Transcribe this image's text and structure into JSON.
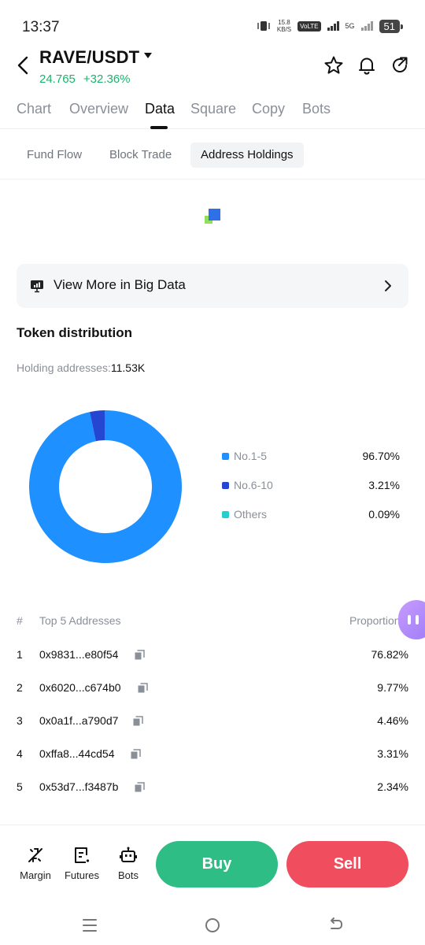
{
  "status_bar": {
    "time": "13:37",
    "speed_value": "15.8",
    "speed_unit": "KB/S",
    "volte": "VoLTE",
    "sim_slot": "1\n2",
    "network": "5G",
    "battery": "51"
  },
  "header": {
    "pair": "RAVE/USDT",
    "price": "24.765",
    "change": "+32.36%",
    "colors": {
      "up": "#1bb36b"
    },
    "icons": [
      "star-icon",
      "bell-icon",
      "share-icon"
    ]
  },
  "main_tabs": [
    {
      "label": "Chart"
    },
    {
      "label": "Overview"
    },
    {
      "label": "Data",
      "active": true
    },
    {
      "label": "Square"
    },
    {
      "label": "Copy"
    },
    {
      "label": "Bots"
    }
  ],
  "sub_tabs": [
    {
      "label": "Fund Flow"
    },
    {
      "label": "Block Trade"
    },
    {
      "label": "Address Holdings",
      "active": true
    }
  ],
  "big_data_banner": {
    "label": "View More in Big Data"
  },
  "token_distribution": {
    "title": "Token distribution",
    "holding_label": "Holding addresses:",
    "holding_value": "11.53K"
  },
  "chart_data": {
    "type": "pie",
    "style": "donut",
    "slices": [
      {
        "label": "No.1-5",
        "value": 96.7,
        "display": "96.70%",
        "color": "#1e90ff"
      },
      {
        "label": "No.6-10",
        "value": 3.21,
        "display": "3.21%",
        "color": "#2446d1"
      },
      {
        "label": "Others",
        "value": 0.09,
        "display": "0.09%",
        "color": "#26cfcf"
      }
    ],
    "legend_position": "right"
  },
  "top_addresses": {
    "col_rank": "#",
    "col_address": "Top 5 Addresses",
    "col_proportion": "Proportion",
    "rows": [
      {
        "rank": "1",
        "address": "0x9831...e80f54",
        "proportion": "76.82%"
      },
      {
        "rank": "2",
        "address": "0x6020...c674b0",
        "proportion": "9.77%"
      },
      {
        "rank": "3",
        "address": "0x0a1f...a790d7",
        "proportion": "4.46%"
      },
      {
        "rank": "4",
        "address": "0xffa8...44cd54",
        "proportion": "3.31%"
      },
      {
        "rank": "5",
        "address": "0x53d7...f3487b",
        "proportion": "2.34%"
      }
    ]
  },
  "bottom_bar": {
    "items": [
      {
        "label": "Margin",
        "icon": "margin-icon"
      },
      {
        "label": "Futures",
        "icon": "futures-icon"
      },
      {
        "label": "Bots",
        "icon": "bot-icon"
      }
    ],
    "buy_label": "Buy",
    "sell_label": "Sell",
    "colors": {
      "buy": "#2ebd85",
      "sell": "#f04e5e"
    }
  }
}
